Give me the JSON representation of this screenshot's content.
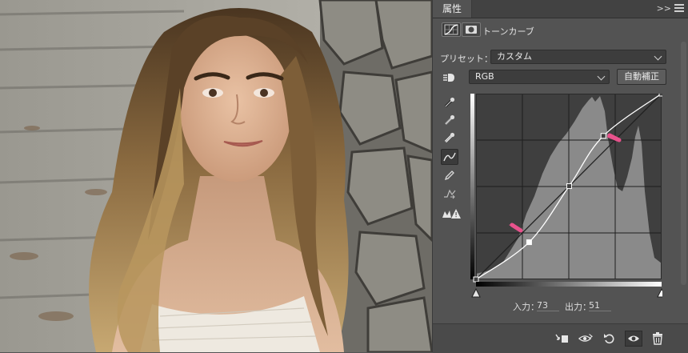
{
  "panel": {
    "title": "属性",
    "collapse_label": ">>",
    "adjustment_type": "トーンカーブ",
    "preset_label": "プリセット：",
    "preset_value": "カスタム",
    "channel_value": "RGB",
    "auto_button": "自動補正",
    "input_label": "入力：",
    "input_value": "73",
    "output_label": "出力：",
    "output_value": "51"
  },
  "curve": {
    "range": [
      0,
      255
    ],
    "points": [
      [
        0,
        0
      ],
      [
        73,
        51
      ],
      [
        128,
        128
      ],
      [
        175,
        197
      ],
      [
        255,
        255
      ]
    ]
  },
  "colors": {
    "panel_bg": "#535353",
    "graph_bg": "#3f3f3f",
    "histogram": "#8a8a8a",
    "annotation_arrow": "#e8528c"
  },
  "icons": {
    "curves_adjustment": "curves-adjustment-icon",
    "layer_mask": "layer-mask-icon",
    "target_adjust": "on-image-adjust-icon",
    "eyedropper_black": "eyedropper-black-point-icon",
    "eyedropper_gray": "eyedropper-gray-point-icon",
    "eyedropper_white": "eyedropper-white-point-icon",
    "curve_point": "edit-points-icon",
    "pencil": "pencil-icon",
    "smooth": "smooth-curve-icon",
    "clipping_warning": "clipping-warning-icon",
    "clip_to_layer": "clip-to-layer-icon",
    "view_previous": "view-previous-state-icon",
    "reset": "reset-icon",
    "visibility": "eye-icon",
    "delete": "trash-icon"
  }
}
